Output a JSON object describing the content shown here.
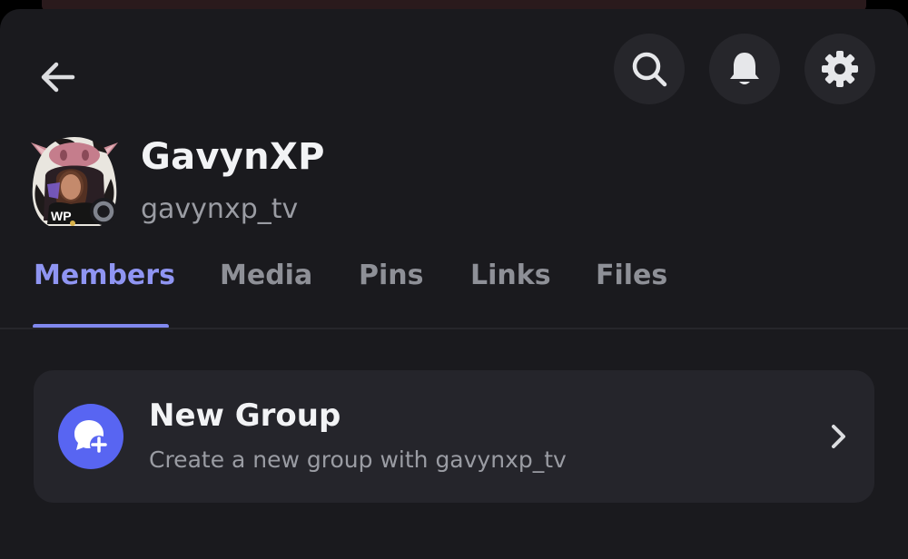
{
  "header": {
    "back_icon": "arrow-left-icon",
    "actions": [
      {
        "icon": "search-icon"
      },
      {
        "icon": "bell-icon"
      },
      {
        "icon": "gear-icon"
      }
    ]
  },
  "profile": {
    "display_name": "GavynXP",
    "username": "gavynxp_tv",
    "avatar_text": "WP",
    "status": "offline"
  },
  "tabs": [
    {
      "label": "Members",
      "active": true
    },
    {
      "label": "Media",
      "active": false
    },
    {
      "label": "Pins",
      "active": false
    },
    {
      "label": "Links",
      "active": false
    },
    {
      "label": "Files",
      "active": false
    }
  ],
  "new_group": {
    "title": "New Group",
    "subtitle": "Create a new group with gavynxp_tv",
    "icon": "chat-bubble-plus-icon"
  },
  "colors": {
    "background": "#1a1a1e",
    "active_tab": "#8f95f2",
    "accent": "#5865f2"
  }
}
